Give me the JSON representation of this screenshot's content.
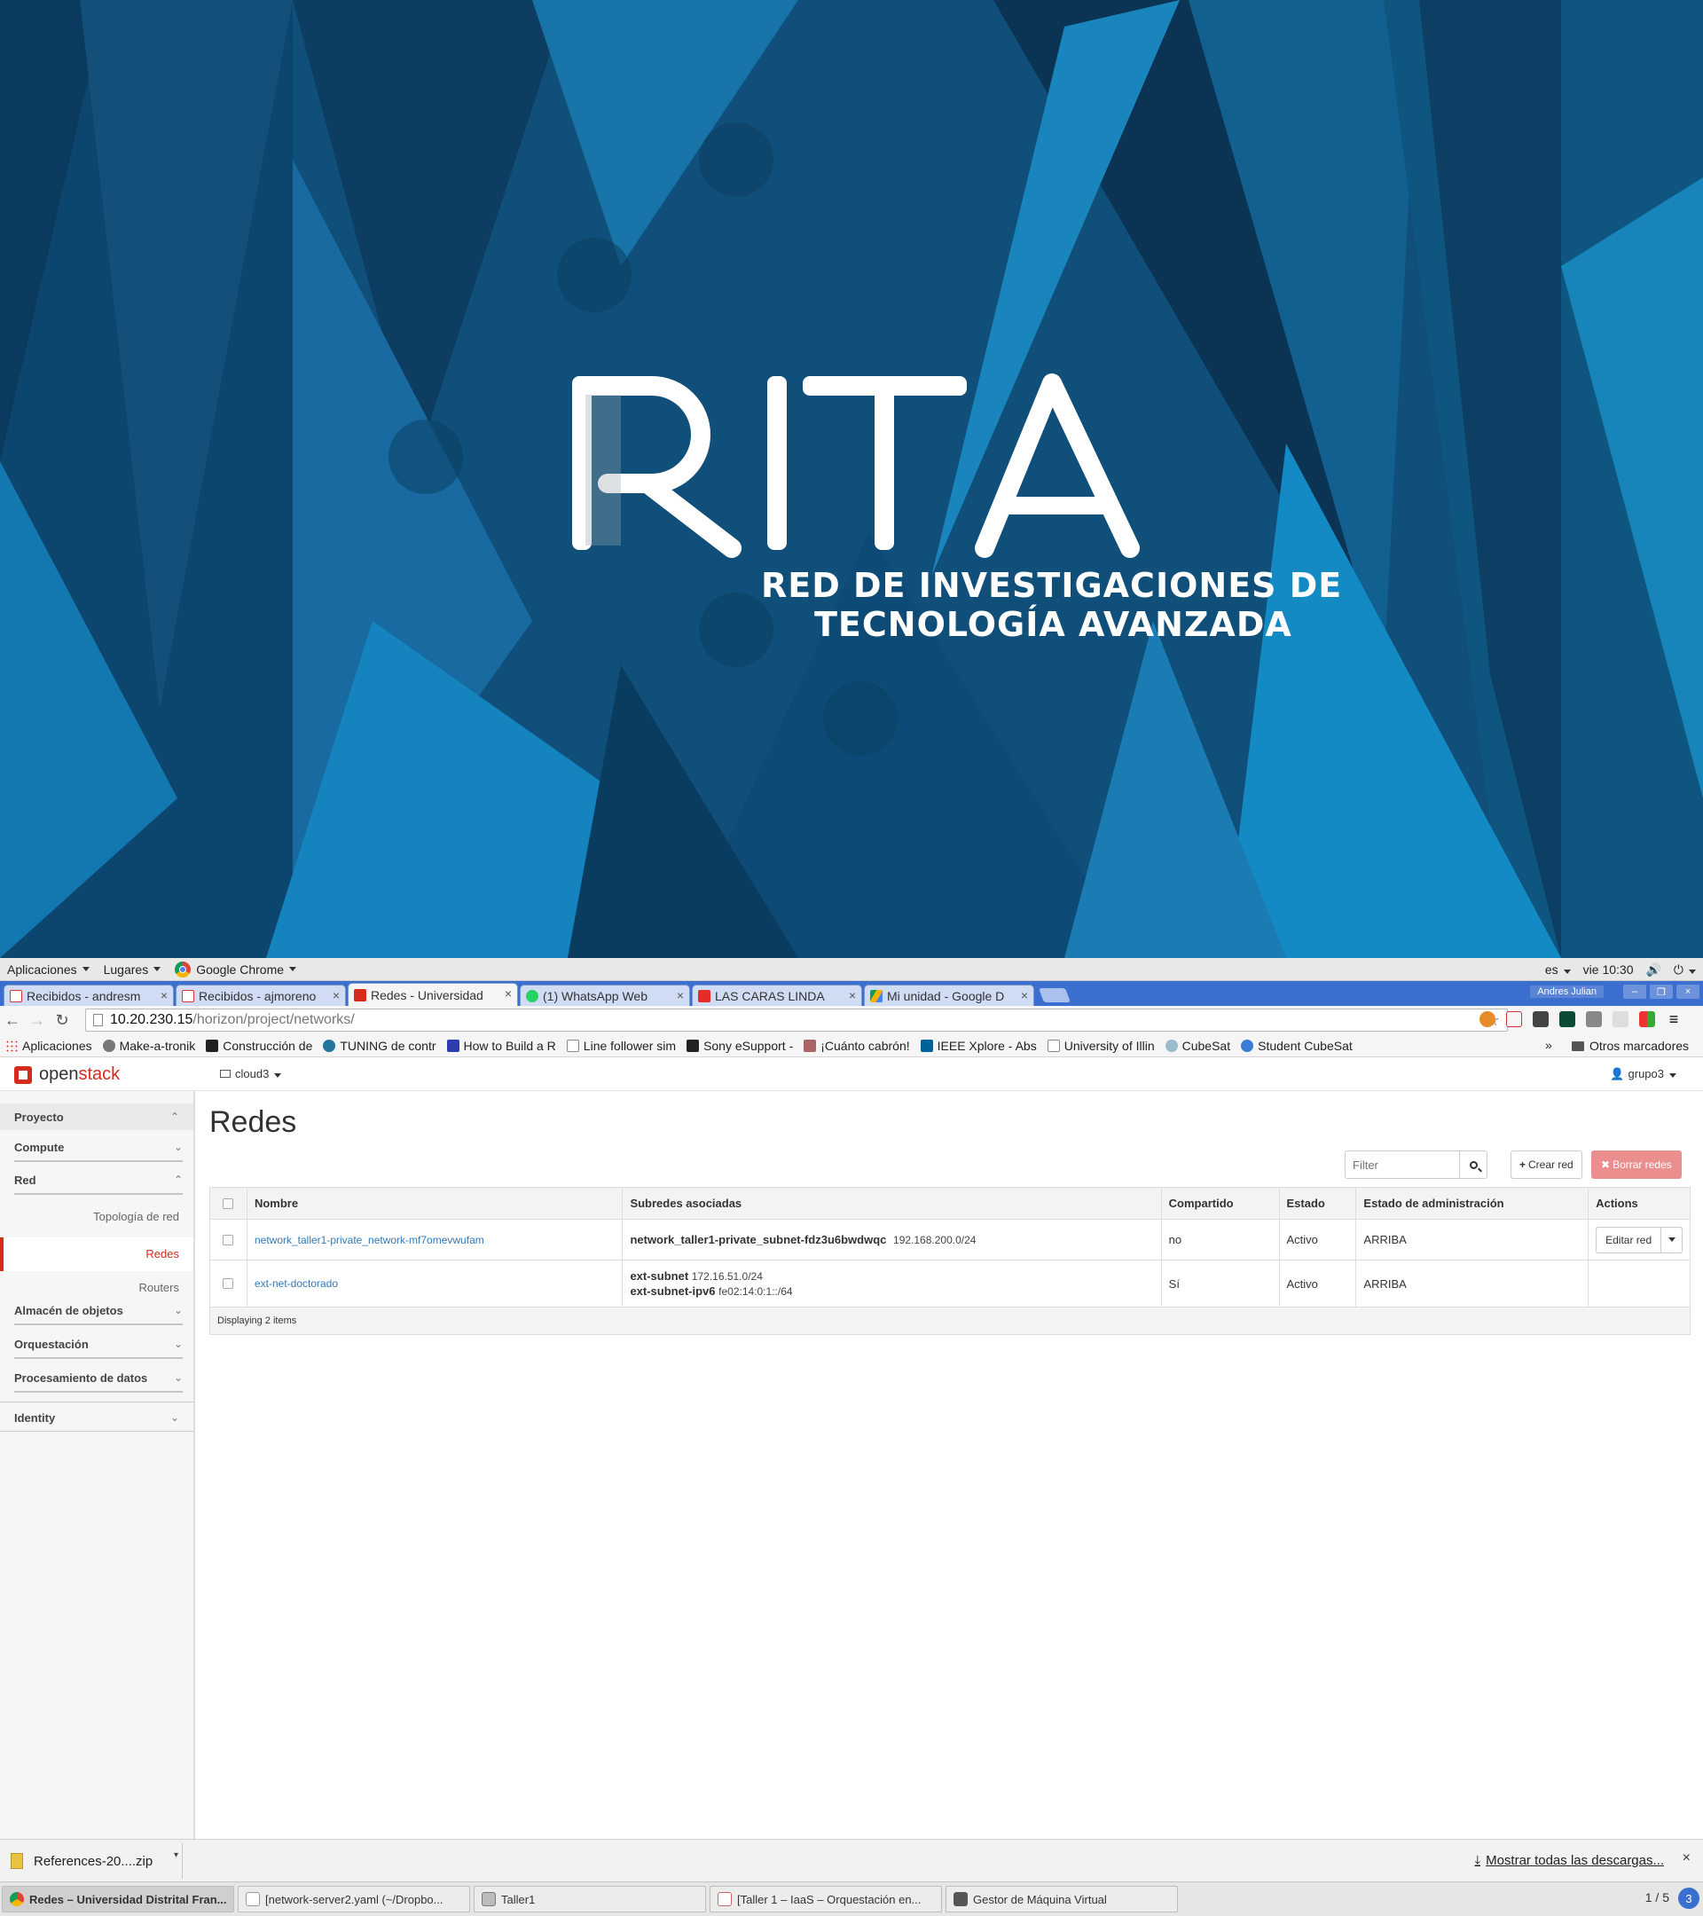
{
  "wallpaper": {
    "logo_text": "RITA",
    "subtitle_line1": "RED DE INVESTIGACIONES DE",
    "subtitle_line2": "TECNOLOGÍA AVANZADA"
  },
  "gnome_panel": {
    "menu_apps": "Aplicaciones",
    "menu_places": "Lugares",
    "menu_chrome": "Google Chrome",
    "lang": "es",
    "clock": "vie 10:30"
  },
  "browser": {
    "tabs": [
      {
        "title": "Recibidos - andresm",
        "icon": "gmail-icon"
      },
      {
        "title": "Recibidos - ajmoreno",
        "icon": "gmail-icon"
      },
      {
        "title": "Redes - Universidad",
        "icon": "openstack-icon"
      },
      {
        "title": "(1) WhatsApp Web",
        "icon": "whatsapp-icon"
      },
      {
        "title": "LAS CARAS LINDA",
        "icon": "youtube-icon"
      },
      {
        "title": "Mi unidad - Google D",
        "icon": "drive-icon"
      }
    ],
    "window_user": "Andres Julian",
    "url_host": "10.20.230.15",
    "url_path": "/horizon/project/networks/",
    "bookmarks": [
      "Aplicaciones",
      "Make-a-tronik",
      "Construcción de",
      "TUNING de contr",
      "How to Build a R",
      "Line follower sim",
      "Sony eSupport -",
      "¡Cuánto cabrón!",
      "IEEE Xplore - Abs",
      "University of Illin",
      "CubeSat",
      "Student CubeSat"
    ],
    "bookmarks_more": "»",
    "bookmarks_other": "Otros marcadores"
  },
  "horizon": {
    "logo_part1": "open",
    "logo_part2": "stack",
    "project_selector": "cloud3",
    "user_menu": "grupo3",
    "sidebar": {
      "proyecto": "Proyecto",
      "compute": "Compute",
      "red": "Red",
      "topologia": "Topología de red",
      "redes": "Redes",
      "routers": "Routers",
      "almacen": "Almacén de objetos",
      "orquestacion": "Orquestación",
      "procesamiento": "Procesamiento de datos",
      "identity": "Identity"
    },
    "page_title": "Redes",
    "filter_placeholder": "Filter",
    "create_label": "Crear red",
    "delete_label": "Borrar redes",
    "table": {
      "headers": [
        "Nombre",
        "Subredes asociadas",
        "Compartido",
        "Estado",
        "Estado de administración",
        "Actions"
      ],
      "rows": [
        {
          "name": "network_taller1-private_network-mf7omevwufam",
          "subnets": [
            {
              "name": "network_taller1-private_subnet-fdz3u6bwdwqc",
              "cidr": "192.168.200.0/24"
            }
          ],
          "shared": "no",
          "status": "Activo",
          "admin_state": "ARRIBA",
          "action": "Editar red"
        },
        {
          "name": "ext-net-doctorado",
          "subnets": [
            {
              "name": "ext-subnet",
              "cidr": "172.16.51.0/24"
            },
            {
              "name": "ext-subnet-ipv6",
              "cidr": "fe02:14:0:1::/64"
            }
          ],
          "shared": "Sí",
          "status": "Activo",
          "admin_state": "ARRIBA",
          "action": ""
        }
      ],
      "footer": "Displaying 2 items"
    }
  },
  "downloads": {
    "file": "References-20....zip",
    "show_all": "Mostrar todas las descargas..."
  },
  "taskbar": {
    "items": [
      "Redes – Universidad Distrital Fran...",
      "[network-server2.yaml (~/Dropbo...",
      "Taller1",
      "[Taller 1 – IaaS – Orquestación en...",
      "Gestor de Máquina Virtual"
    ],
    "pager": "1 / 5",
    "workspace_badge": "3"
  }
}
